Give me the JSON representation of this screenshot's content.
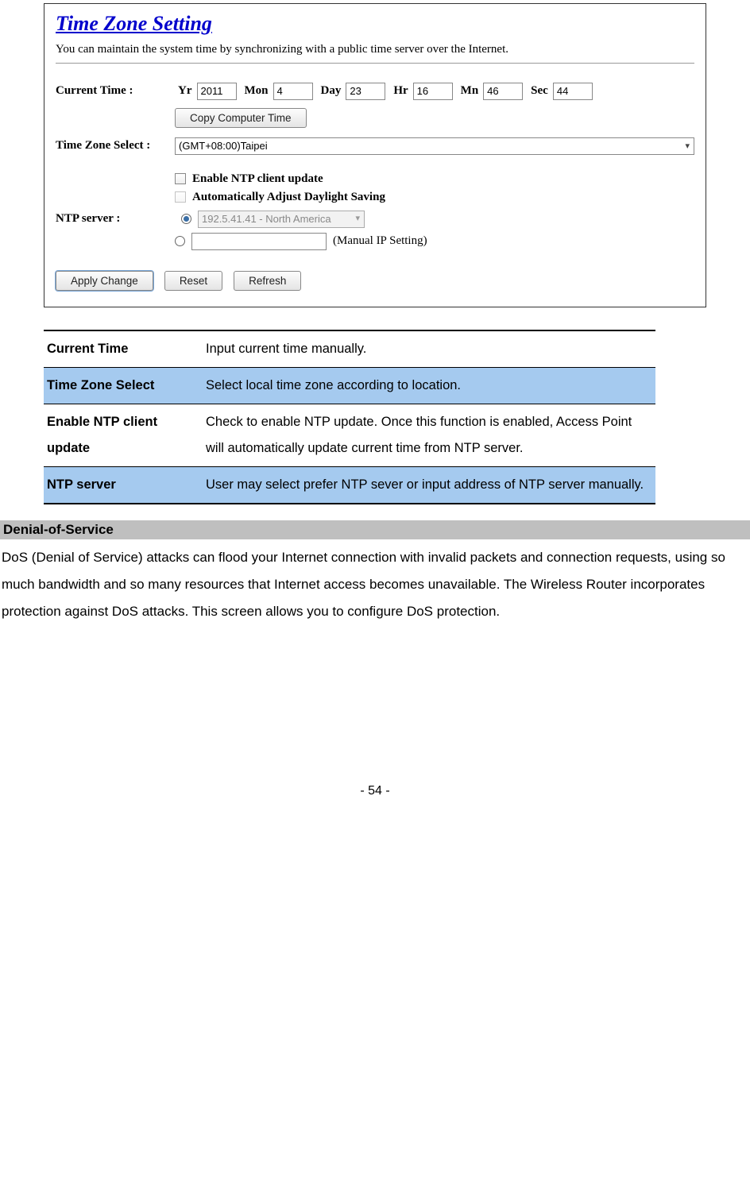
{
  "screenshot": {
    "title": "Time Zone Setting",
    "description": "You can maintain the system time by synchronizing with a public time server over the Internet.",
    "current_time_label": "Current Time :",
    "fields": {
      "yr": {
        "label": "Yr",
        "value": "2011"
      },
      "mon": {
        "label": "Mon",
        "value": "4"
      },
      "day": {
        "label": "Day",
        "value": "23"
      },
      "hr": {
        "label": "Hr",
        "value": "16"
      },
      "mn": {
        "label": "Mn",
        "value": "46"
      },
      "sec": {
        "label": "Sec",
        "value": "44"
      }
    },
    "copy_button": "Copy Computer Time",
    "tz_label": "Time Zone Select :",
    "tz_value": "(GMT+08:00)Taipei",
    "enable_ntp": "Enable NTP client update",
    "auto_dst": "Automatically Adjust Daylight Saving",
    "ntp_server_label": "NTP server :",
    "ntp_select_value": "192.5.41.41 - North America",
    "manual_ip_label": "(Manual IP Setting)",
    "apply_btn": "Apply Change",
    "reset_btn": "Reset",
    "refresh_btn": "Refresh"
  },
  "table": {
    "rows": [
      {
        "k": "Current Time",
        "v": "Input current time manually.",
        "hl": false
      },
      {
        "k": "Time Zone Select",
        "v": "Select local time zone according to location.",
        "hl": true
      },
      {
        "k": "Enable NTP client update",
        "v": "Check to enable NTP update. Once this function is enabled, Access Point will automatically update current time from NTP server.",
        "hl": false
      },
      {
        "k": "NTP server",
        "v": "User may select prefer NTP sever or input address of NTP server manually.",
        "hl": true
      }
    ]
  },
  "section": {
    "heading": "Denial-of-Service",
    "body": "DoS (Denial of Service) attacks can flood your Internet connection with invalid packets and connection requests, using so much bandwidth and so many resources that Internet access becomes unavailable. The Wireless Router incorporates protection against DoS attacks. This screen allows you to configure DoS protection."
  },
  "page_number": "- 54 -"
}
